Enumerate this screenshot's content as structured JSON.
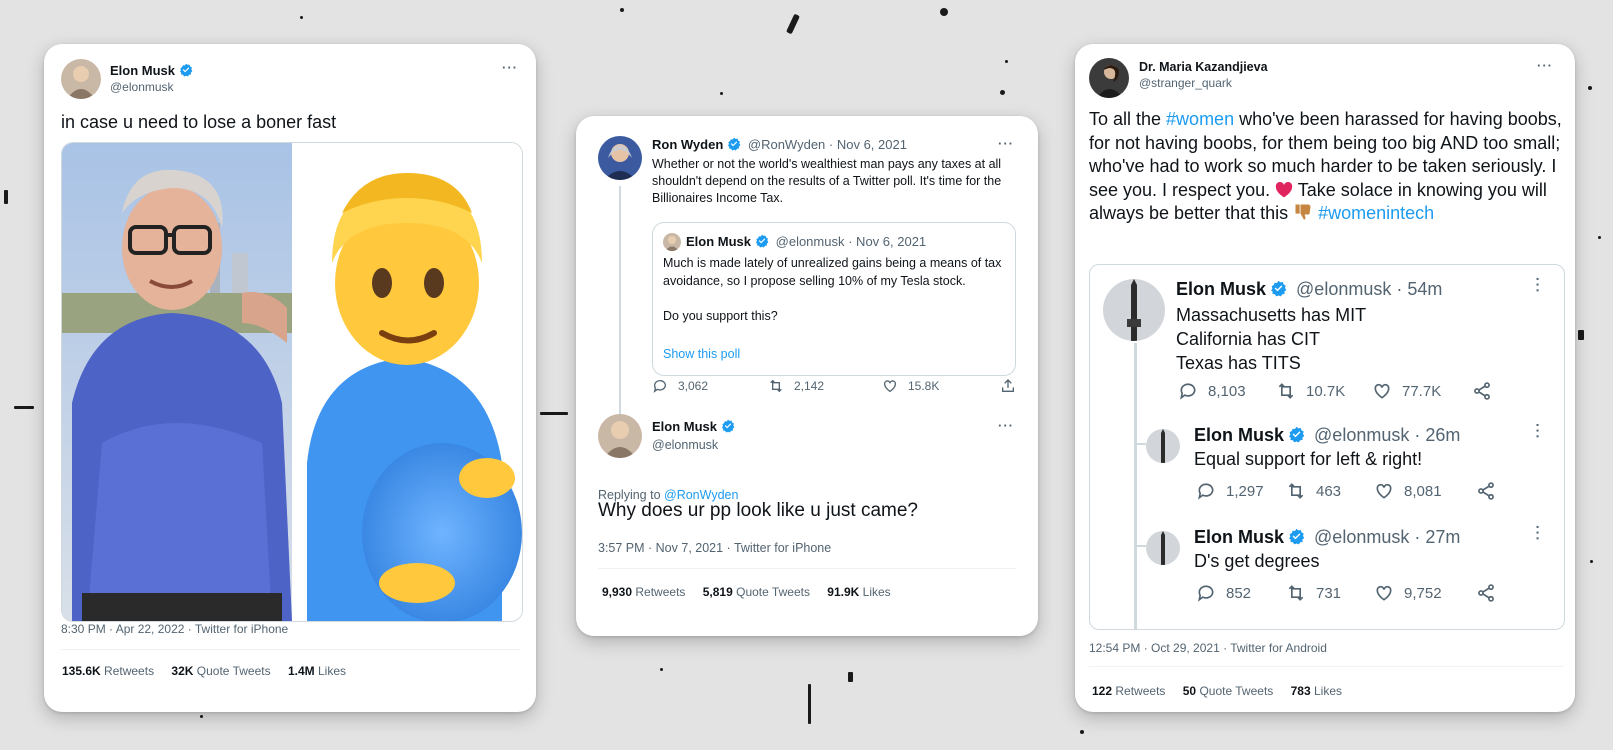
{
  "colors": {
    "link": "#1d9bf0",
    "verified": "#1d9bf0",
    "heart": "#e0245e",
    "background": "#e3e3e3"
  },
  "card1": {
    "author_name": "Elon Musk",
    "author_handle": "@elonmusk",
    "text": "in case u need to lose a boner fast",
    "meta": "8:30 PM · Apr 22, 2022 · Twitter for iPhone",
    "stats": [
      {
        "value": "135.6K",
        "label": "Retweets"
      },
      {
        "value": "32K",
        "label": "Quote Tweets"
      },
      {
        "value": "1.4M",
        "label": "Likes"
      }
    ]
  },
  "card2": {
    "parent": {
      "author_name": "Ron Wyden",
      "author_handle": "@RonWyden",
      "date": "· Nov 6, 2021",
      "text": "Whether or not the world's wealthiest man pays any taxes at all shouldn't depend on the results of a Twitter poll. It's time for the Billionaires Income Tax.",
      "quote": {
        "author_name": "Elon Musk",
        "author_handle": "@elonmusk",
        "date": "· Nov 6, 2021",
        "text": "Much is made lately of unrealized gains being a means of tax avoidance, so I propose selling 10% of my Tesla stock.\n\nDo you support this?",
        "poll_link": "Show this poll"
      },
      "replies": "3,062",
      "retweets": "2,142",
      "likes": "15.8K"
    },
    "reply": {
      "author_name": "Elon Musk",
      "author_handle": "@elonmusk",
      "replying_prefix": "Replying to ",
      "replying_to": "@RonWyden",
      "text": "Why does ur pp look like u just came?",
      "meta": "3:57 PM · Nov 7, 2021 · Twitter for iPhone",
      "stats": [
        {
          "value": "9,930",
          "label": "Retweets"
        },
        {
          "value": "5,819",
          "label": "Quote Tweets"
        },
        {
          "value": "91.9K",
          "label": "Likes"
        }
      ]
    }
  },
  "card3": {
    "author_name": "Dr. Maria Kazandjieva",
    "author_handle": "@stranger_quark",
    "text_parts": [
      "To all the ",
      "#women",
      " who've been harassed for having boobs, for not having boobs, for them being too big AND too small; who've had to work so much harder to be taken seriously. I see you. I respect you. ",
      " Take solace in knowing you will always be better that this ",
      "#womenintech"
    ],
    "embedded": [
      {
        "author_name": "Elon Musk",
        "author_handle": "@elonmusk",
        "time": "· 54m",
        "text": "Massachusetts has MIT\nCalifornia has CIT\nTexas has TITS",
        "replies": "8,103",
        "retweets": "10.7K",
        "likes": "77.7K"
      },
      {
        "author_name": "Elon Musk",
        "author_handle": "@elonmusk",
        "time": "· 26m",
        "text": "Equal support for left & right!",
        "replies": "1,297",
        "retweets": "463",
        "likes": "8,081"
      },
      {
        "author_name": "Elon Musk",
        "author_handle": "@elonmusk",
        "time": "· 27m",
        "text": "D's get degrees",
        "replies": "852",
        "retweets": "731",
        "likes": "9,752"
      }
    ],
    "meta": "12:54 PM · Oct 29, 2021 · Twitter for Android",
    "stats": [
      {
        "value": "122",
        "label": "Retweets"
      },
      {
        "value": "50",
        "label": "Quote Tweets"
      },
      {
        "value": "783",
        "label": "Likes"
      }
    ]
  }
}
